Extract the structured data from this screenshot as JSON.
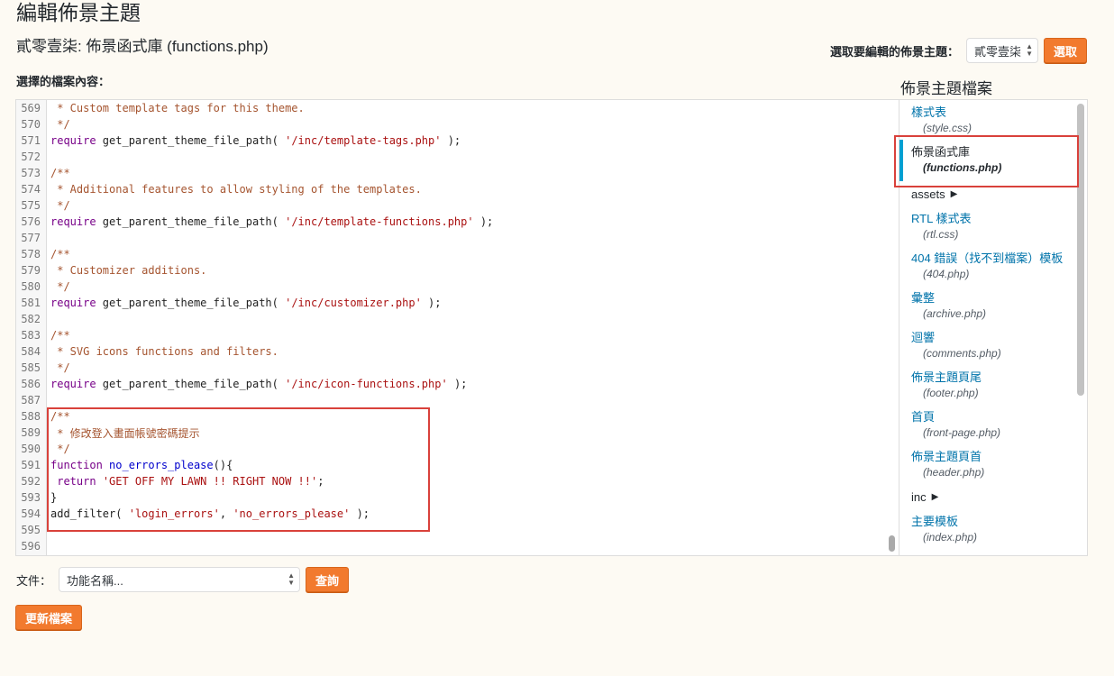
{
  "page_title": "編輯佈景主題",
  "file_heading": "貳零壹柒: 佈景函式庫 (functions.php)",
  "theme_select": {
    "label": "選取要編輯的佈景主題：",
    "value": "貳零壹柒",
    "button": "選取"
  },
  "content_label": "選擇的檔案內容：",
  "sidebar_heading": "佈景主題檔案",
  "code_lines": [
    {
      "n": "569",
      "t": " * Custom template tags for this theme.",
      "k": "comment"
    },
    {
      "n": "570",
      "t": " */",
      "k": "comment"
    },
    {
      "n": "571",
      "t": "",
      "k": "require",
      "a": "require",
      "b": " get_parent_theme_file_path( ",
      "c": "'/inc/template-tags.php'",
      "d": " );"
    },
    {
      "n": "572",
      "t": "",
      "k": "blank"
    },
    {
      "n": "573",
      "t": "/**",
      "k": "comment"
    },
    {
      "n": "574",
      "t": " * Additional features to allow styling of the templates.",
      "k": "comment"
    },
    {
      "n": "575",
      "t": " */",
      "k": "comment"
    },
    {
      "n": "576",
      "t": "",
      "k": "require",
      "a": "require",
      "b": " get_parent_theme_file_path( ",
      "c": "'/inc/template-functions.php'",
      "d": " );"
    },
    {
      "n": "577",
      "t": "",
      "k": "blank"
    },
    {
      "n": "578",
      "t": "/**",
      "k": "comment"
    },
    {
      "n": "579",
      "t": " * Customizer additions.",
      "k": "comment"
    },
    {
      "n": "580",
      "t": " */",
      "k": "comment"
    },
    {
      "n": "581",
      "t": "",
      "k": "require",
      "a": "require",
      "b": " get_parent_theme_file_path( ",
      "c": "'/inc/customizer.php'",
      "d": " );"
    },
    {
      "n": "582",
      "t": "",
      "k": "blank"
    },
    {
      "n": "583",
      "t": "/**",
      "k": "comment"
    },
    {
      "n": "584",
      "t": " * SVG icons functions and filters.",
      "k": "comment"
    },
    {
      "n": "585",
      "t": " */",
      "k": "comment"
    },
    {
      "n": "586",
      "t": "",
      "k": "require",
      "a": "require",
      "b": " get_parent_theme_file_path( ",
      "c": "'/inc/icon-functions.php'",
      "d": " );"
    },
    {
      "n": "587",
      "t": "",
      "k": "blank"
    },
    {
      "n": "588",
      "t": "/**",
      "k": "comment"
    },
    {
      "n": "589",
      "t": " * 修改登入畫面帳號密碼提示",
      "k": "comment"
    },
    {
      "n": "590",
      "t": " */",
      "k": "comment"
    },
    {
      "n": "591",
      "t": "",
      "k": "func",
      "a": "function",
      "b": " ",
      "c": "no_errors_please",
      "d": "(){"
    },
    {
      "n": "592",
      "t": "",
      "k": "return",
      "a": " return",
      "b": " ",
      "c": "'GET OFF MY LAWN !! RIGHT NOW !!'",
      "d": ";"
    },
    {
      "n": "593",
      "t": "}",
      "k": "plain"
    },
    {
      "n": "594",
      "t": "",
      "k": "filter",
      "a": "add_filter( ",
      "b": "'login_errors'",
      "c": ", ",
      "d": "'no_errors_please'",
      "e": " );"
    },
    {
      "n": "595",
      "t": "",
      "k": "blank"
    },
    {
      "n": "596",
      "t": "",
      "k": "blank"
    }
  ],
  "files": [
    {
      "type": "file",
      "name": "樣式表",
      "path": "(style.css)"
    },
    {
      "type": "file",
      "name": "佈景函式庫",
      "path": "(functions.php)",
      "active": true
    },
    {
      "type": "folder",
      "name": "assets"
    },
    {
      "type": "file",
      "name": "RTL 樣式表",
      "path": "(rtl.css)"
    },
    {
      "type": "file",
      "name": "404 錯誤（找不到檔案）模板",
      "path": "(404.php)"
    },
    {
      "type": "file",
      "name": "彙整",
      "path": "(archive.php)"
    },
    {
      "type": "file",
      "name": "迴響",
      "path": "(comments.php)"
    },
    {
      "type": "file",
      "name": "佈景主題頁尾",
      "path": "(footer.php)"
    },
    {
      "type": "file",
      "name": "首頁",
      "path": "(front-page.php)"
    },
    {
      "type": "file",
      "name": "佈景主題頁首",
      "path": "(header.php)"
    },
    {
      "type": "folder",
      "name": "inc"
    },
    {
      "type": "file",
      "name": "主要模板",
      "path": "(index.php)"
    }
  ],
  "doc": {
    "label": "文件：",
    "placeholder": "功能名稱...",
    "button": "查詢"
  },
  "update_button": "更新檔案",
  "colors": {
    "accent": "#f27a2e",
    "highlight": "#d9413b",
    "active_file_bar": "#00a0d2"
  }
}
